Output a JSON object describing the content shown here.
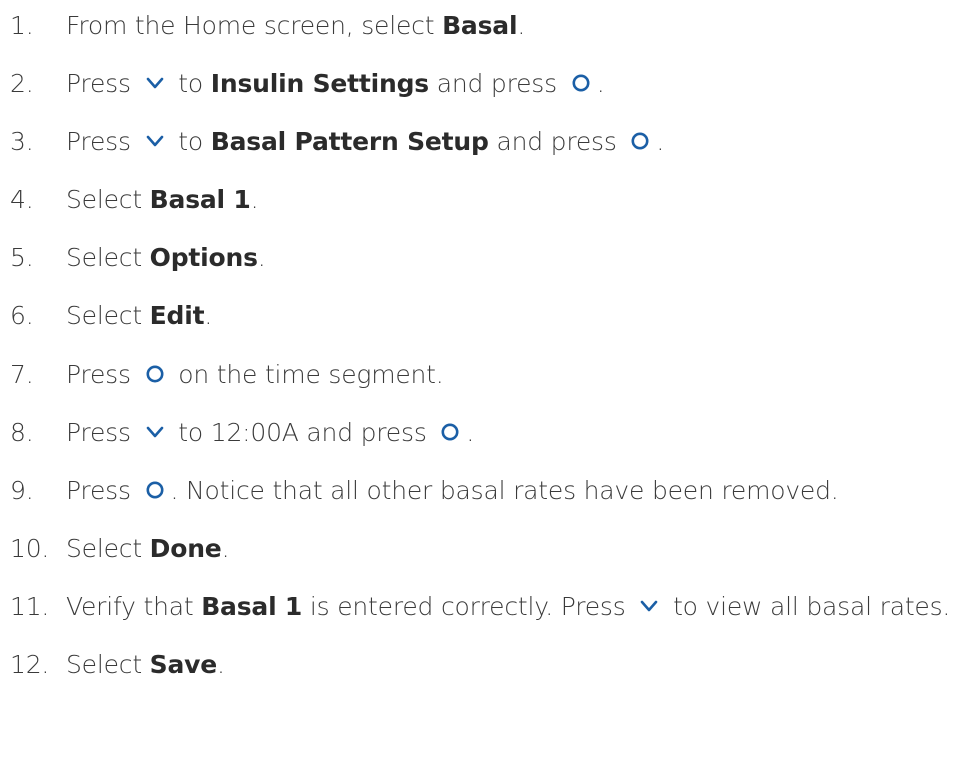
{
  "accent_color": "#1b5fa6",
  "steps": [
    {
      "number": "1.",
      "parts": [
        {
          "type": "text",
          "value": "From the Home screen, select "
        },
        {
          "type": "bold",
          "value": "Basal"
        },
        {
          "type": "text",
          "value": "."
        }
      ]
    },
    {
      "number": "2.",
      "parts": [
        {
          "type": "text",
          "value": "Press "
        },
        {
          "type": "icon",
          "value": "chevron-down-icon"
        },
        {
          "type": "text",
          "value": " to "
        },
        {
          "type": "bold",
          "value": "Insulin Settings"
        },
        {
          "type": "text",
          "value": " and press "
        },
        {
          "type": "icon",
          "value": "select-circle-icon"
        },
        {
          "type": "text",
          "value": "."
        }
      ]
    },
    {
      "number": "3.",
      "parts": [
        {
          "type": "text",
          "value": "Press "
        },
        {
          "type": "icon",
          "value": "chevron-down-icon"
        },
        {
          "type": "text",
          "value": " to "
        },
        {
          "type": "bold",
          "value": "Basal Pattern Setup"
        },
        {
          "type": "text",
          "value": " and press "
        },
        {
          "type": "icon",
          "value": "select-circle-icon"
        },
        {
          "type": "text",
          "value": "."
        }
      ]
    },
    {
      "number": "4.",
      "parts": [
        {
          "type": "text",
          "value": "Select "
        },
        {
          "type": "bold",
          "value": "Basal 1"
        },
        {
          "type": "text",
          "value": "."
        }
      ]
    },
    {
      "number": "5.",
      "parts": [
        {
          "type": "text",
          "value": "Select "
        },
        {
          "type": "bold",
          "value": "Options"
        },
        {
          "type": "text",
          "value": "."
        }
      ]
    },
    {
      "number": "6.",
      "parts": [
        {
          "type": "text",
          "value": "Select "
        },
        {
          "type": "bold",
          "value": "Edit"
        },
        {
          "type": "text",
          "value": "."
        }
      ]
    },
    {
      "number": "7.",
      "parts": [
        {
          "type": "text",
          "value": "Press "
        },
        {
          "type": "icon",
          "value": "select-circle-icon"
        },
        {
          "type": "text",
          "value": " on the time segment."
        }
      ]
    },
    {
      "number": "8.",
      "parts": [
        {
          "type": "text",
          "value": "Press "
        },
        {
          "type": "icon",
          "value": "chevron-down-icon"
        },
        {
          "type": "text",
          "value": " to 12:00A and press "
        },
        {
          "type": "icon",
          "value": "select-circle-icon"
        },
        {
          "type": "text",
          "value": "."
        }
      ]
    },
    {
      "number": "9.",
      "parts": [
        {
          "type": "text",
          "value": "Press "
        },
        {
          "type": "icon",
          "value": "select-circle-icon"
        },
        {
          "type": "text",
          "value": ". Notice that all other basal rates have been removed."
        }
      ]
    },
    {
      "number": "10.",
      "parts": [
        {
          "type": "text",
          "value": "Select "
        },
        {
          "type": "bold",
          "value": "Done"
        },
        {
          "type": "text",
          "value": "."
        }
      ]
    },
    {
      "number": "11.",
      "parts": [
        {
          "type": "text",
          "value": "Verify that "
        },
        {
          "type": "bold",
          "value": "Basal 1"
        },
        {
          "type": "text",
          "value": " is entered correctly. Press "
        },
        {
          "type": "icon",
          "value": "chevron-down-icon"
        },
        {
          "type": "text",
          "value": " to view all basal rates."
        }
      ]
    },
    {
      "number": "12.",
      "parts": [
        {
          "type": "text",
          "value": "Select "
        },
        {
          "type": "bold",
          "value": "Save"
        },
        {
          "type": "text",
          "value": "."
        }
      ]
    }
  ]
}
